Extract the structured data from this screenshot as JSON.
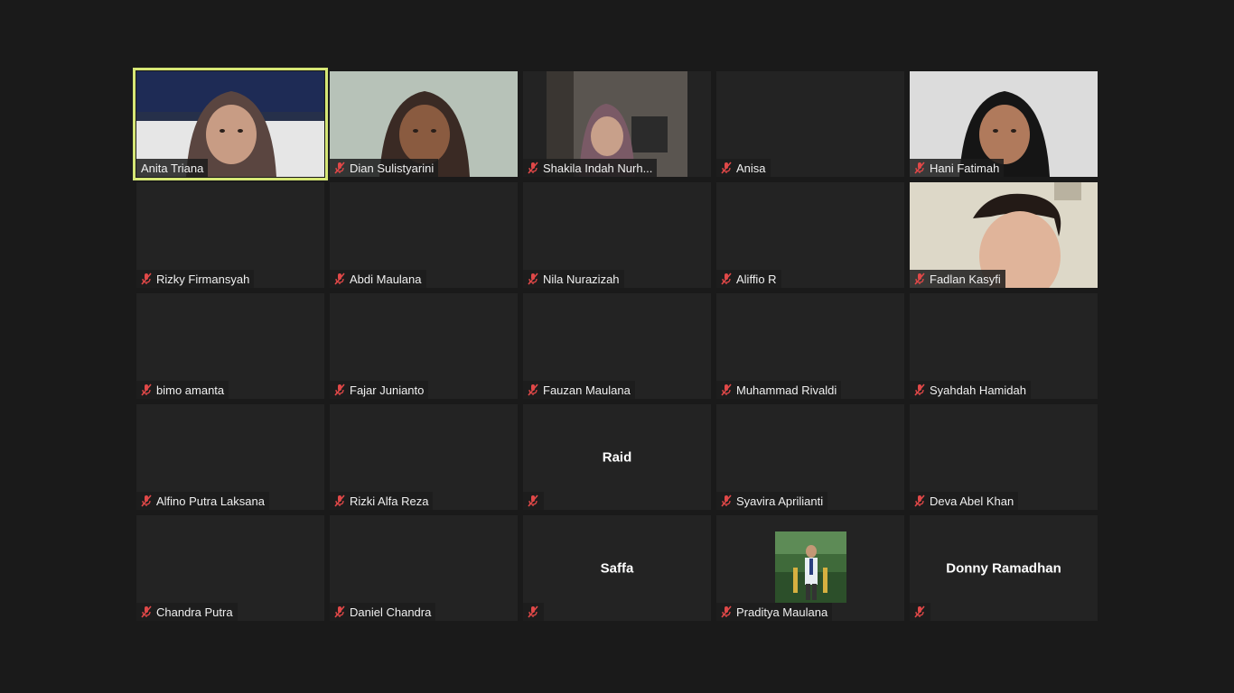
{
  "muted_icon": "mic-muted-icon",
  "active_speaker_color": "#d6e776",
  "participants": [
    {
      "name": "Anita Triana",
      "muted": false,
      "video": "on",
      "speaking": true
    },
    {
      "name": "Dian Sulistyarini",
      "muted": true,
      "video": "on"
    },
    {
      "name": "Shakila Indah Nurh...",
      "muted": true,
      "video": "on"
    },
    {
      "name": "Anisa",
      "muted": true,
      "video": "off"
    },
    {
      "name": "Hani Fatimah",
      "muted": true,
      "video": "on"
    },
    {
      "name": "Rizky Firmansyah",
      "muted": true,
      "video": "off"
    },
    {
      "name": "Abdi Maulana",
      "muted": true,
      "video": "off"
    },
    {
      "name": "Nila Nurazizah",
      "muted": true,
      "video": "off"
    },
    {
      "name": "Aliffio R",
      "muted": true,
      "video": "off"
    },
    {
      "name": "Fadlan Kasyfi",
      "muted": true,
      "video": "on"
    },
    {
      "name": "bimo amanta",
      "muted": true,
      "video": "off"
    },
    {
      "name": "Fajar Junianto",
      "muted": true,
      "video": "off"
    },
    {
      "name": "Fauzan Maulana",
      "muted": true,
      "video": "off"
    },
    {
      "name": "Muhammad Rivaldi",
      "muted": true,
      "video": "off"
    },
    {
      "name": "Syahdah Hamidah",
      "muted": true,
      "video": "off"
    },
    {
      "name": "Alfino Putra Laksana",
      "muted": true,
      "video": "off"
    },
    {
      "name": "Rizki Alfa Reza",
      "muted": true,
      "video": "off"
    },
    {
      "name": "",
      "center_name": "Raid",
      "muted": true,
      "video": "off"
    },
    {
      "name": "Syavira Aprilianti",
      "muted": true,
      "video": "off"
    },
    {
      "name": "Deva Abel Khan",
      "muted": true,
      "video": "off"
    },
    {
      "name": "Chandra Putra",
      "muted": true,
      "video": "off"
    },
    {
      "name": "Daniel Chandra",
      "muted": true,
      "video": "off"
    },
    {
      "name": "",
      "center_name": "Saffa",
      "muted": true,
      "video": "off"
    },
    {
      "name": "Praditya Maulana",
      "muted": true,
      "video": "avatar"
    },
    {
      "name": "",
      "center_name": "Donny Ramadhan",
      "muted": true,
      "video": "off"
    }
  ]
}
